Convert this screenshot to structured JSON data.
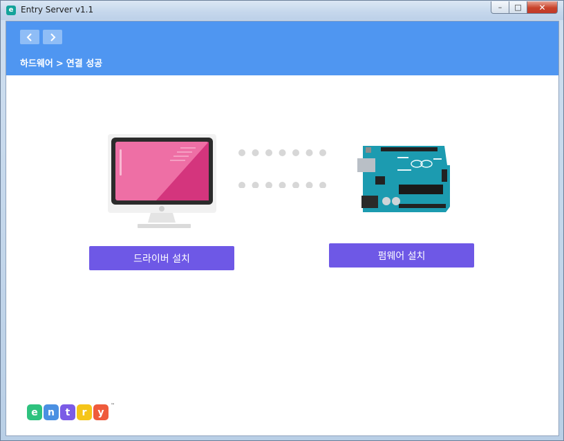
{
  "window": {
    "title": "Entry Server v1.1",
    "app_icon_letter": "e",
    "minimize_glyph": "–",
    "maximize_glyph": "□",
    "close_glyph": "✕"
  },
  "header": {
    "back_icon": "chevron-left-icon",
    "forward_icon": "chevron-right-icon",
    "breadcrumb": {
      "parent": "하드웨어",
      "separator": ">",
      "current": "연결 성공"
    },
    "color": "#4f96f1"
  },
  "main": {
    "driver_button_label": "드라이버 설치",
    "firmware_button_label": "펌웨어 설치",
    "button_color": "#6e58e6",
    "illustrations": [
      "monitor-icon",
      "connection-dots",
      "arduino-board-icon"
    ]
  },
  "logo": {
    "letters": [
      {
        "char": "e",
        "color": "#2ec27e"
      },
      {
        "char": "n",
        "color": "#4a90e2"
      },
      {
        "char": "t",
        "color": "#7b5ce6"
      },
      {
        "char": "r",
        "color": "#f5c518"
      },
      {
        "char": "y",
        "color": "#ef5b3c"
      }
    ],
    "tm": "™"
  }
}
